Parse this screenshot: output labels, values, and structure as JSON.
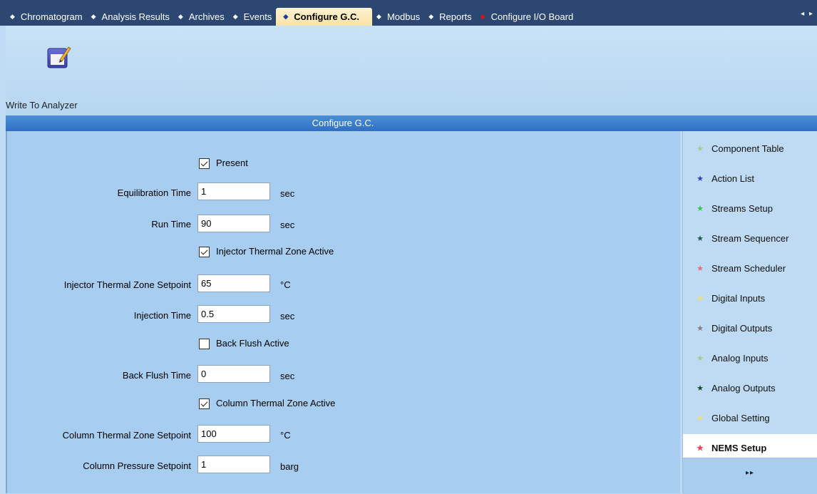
{
  "tabs": [
    {
      "label": "Chromatogram",
      "active": false,
      "dot_color": "#ffffff"
    },
    {
      "label": "Analysis Results",
      "active": false,
      "dot_color": "#ffffff"
    },
    {
      "label": "Archives",
      "active": false,
      "dot_color": "#ffffff"
    },
    {
      "label": "Events",
      "active": false,
      "dot_color": "#ffffff"
    },
    {
      "label": "Configure G.C.",
      "active": true,
      "dot_color": "#1d3f9a"
    },
    {
      "label": "Modbus",
      "active": false,
      "dot_color": "#ffffff"
    },
    {
      "label": "Reports",
      "active": false,
      "dot_color": "#ffffff"
    },
    {
      "label": "Configure I/O Board",
      "active": false,
      "dot_color": "#e01010"
    }
  ],
  "tab_scroll": "◂ ▸",
  "toolbar": {
    "write_label": "Write To Analyzer",
    "write_icon": "write-to-analyzer-icon"
  },
  "panel": {
    "title": "Configure G.C."
  },
  "form": {
    "present": {
      "label": "Present",
      "checked": true
    },
    "equilibration_time": {
      "label": "Equilibration Time",
      "value": "1",
      "unit": "sec"
    },
    "run_time": {
      "label": "Run Time",
      "value": "90",
      "unit": "sec"
    },
    "injector_zone_active": {
      "label": "Injector Thermal Zone Active",
      "checked": true
    },
    "injector_setpoint": {
      "label": "Injector Thermal Zone Setpoint",
      "value": "65",
      "unit": "°C"
    },
    "injection_time": {
      "label": "Injection Time",
      "value": "0.5",
      "unit": "sec"
    },
    "back_flush_active": {
      "label": "Back Flush Active",
      "checked": false
    },
    "back_flush_time": {
      "label": "Back Flush Time",
      "value": "0",
      "unit": "sec"
    },
    "column_zone_active": {
      "label": "Column Thermal Zone Active",
      "checked": true
    },
    "column_setpoint": {
      "label": "Column Thermal Zone Setpoint",
      "value": "100",
      "unit": "°C"
    },
    "column_pressure": {
      "label": "Column Pressure Setpoint",
      "value": "1",
      "unit": "barg"
    }
  },
  "nav": {
    "items": [
      {
        "label": "Component Table",
        "star_color": "#9bcf8c",
        "active": false
      },
      {
        "label": "Action List",
        "star_color": "#2a3fd0",
        "active": false
      },
      {
        "label": "Streams Setup",
        "star_color": "#33c64a",
        "active": false
      },
      {
        "label": "Stream Sequencer",
        "star_color": "#1d5a4a",
        "active": false
      },
      {
        "label": "Stream Scheduler",
        "star_color": "#ee6a7a",
        "active": false
      },
      {
        "label": "Digital Inputs",
        "star_color": "#f5e06a",
        "active": false
      },
      {
        "label": "Digital Outputs",
        "star_color": "#8a7a80",
        "active": false
      },
      {
        "label": "Analog Inputs",
        "star_color": "#9bcf8c",
        "active": false
      },
      {
        "label": "Analog Outputs",
        "star_color": "#124d24",
        "active": false
      },
      {
        "label": "Global Setting",
        "star_color": "#f5e06a",
        "active": false
      },
      {
        "label": "NEMS Setup",
        "star_color": "#ee4455",
        "active": true
      }
    ],
    "more": "▸▸"
  }
}
